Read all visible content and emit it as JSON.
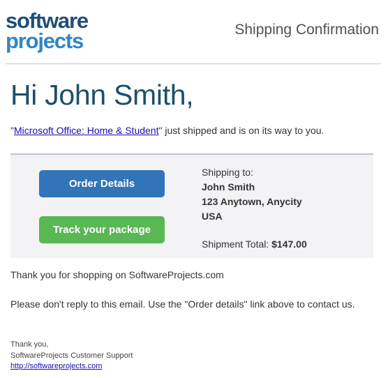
{
  "header": {
    "logo_line1": "software",
    "logo_line2": "projects",
    "title": "Shipping Confirmation"
  },
  "greeting": "Hi John Smith,",
  "shipped": {
    "open_quote": "\"",
    "product_link": "Microsoft Office: Home & Student",
    "rest": "\" just shipped and is on its way to you."
  },
  "panel": {
    "order_button": "Order Details",
    "track_button": "Track your package",
    "shipping_to_label": "Shipping to:",
    "name": "John Smith",
    "address": "123 Anytown, Anycity",
    "country": "USA",
    "total_label": "Shipment Total:",
    "total_value": "$147.00"
  },
  "thanks": "Thank you for shopping on SoftwareProjects.com",
  "noreply": "Please don't reply to this email. Use the \"Order details\" link above to contact us.",
  "signoff": {
    "line1": "Thank you,",
    "line2": "SoftwareProjects Customer Support",
    "link": "http://softwareprojects.com"
  },
  "colors": {
    "brand_dark": "#1f4e79",
    "brand_light": "#2e86c8",
    "greeting": "#1c4f6b",
    "order_button": "#3274b8",
    "track_button": "#59b754",
    "panel_bg": "#f3f3f5",
    "link": "#1a0dab"
  }
}
